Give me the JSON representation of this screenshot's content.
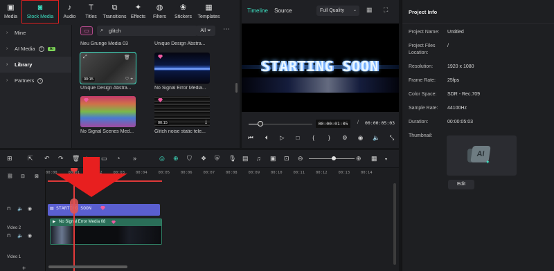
{
  "toolbar": {
    "items": [
      {
        "label": "Media",
        "icon": "media-icon",
        "glyph": "▣"
      },
      {
        "label": "Stock Media",
        "icon": "stock-media-icon",
        "glyph": "◙"
      },
      {
        "label": "Audio",
        "icon": "music-note-icon",
        "glyph": "♪"
      },
      {
        "label": "Titles",
        "icon": "text-icon",
        "glyph": "T"
      },
      {
        "label": "Transitions",
        "icon": "transitions-icon",
        "glyph": "⧉"
      },
      {
        "label": "Effects",
        "icon": "effects-icon",
        "glyph": "✦"
      },
      {
        "label": "Filters",
        "icon": "filters-icon",
        "glyph": "◍"
      },
      {
        "label": "Stickers",
        "icon": "stickers-icon",
        "glyph": "❀"
      },
      {
        "label": "Templates",
        "icon": "templates-icon",
        "glyph": "▦"
      }
    ],
    "active_index": 1
  },
  "sidebar": {
    "items": [
      {
        "label": "Mine"
      },
      {
        "label": "AI Media",
        "badge": "AI"
      },
      {
        "label": "Library"
      },
      {
        "label": "Partners"
      }
    ]
  },
  "search": {
    "value": "glitch",
    "filter_label": "All"
  },
  "media_grid": {
    "top_labels": [
      "Neu Grunge Media 03",
      "Unique Design Abstra..."
    ],
    "tiles": [
      {
        "label": "Unique Design Abstra...",
        "duration": "00:15"
      },
      {
        "label": "No Signal Error Media...",
        "duration": ""
      },
      {
        "label": "No Signal Scenes Med...",
        "duration": ""
      },
      {
        "label": "Glitch noise static tele...",
        "duration": "00:15"
      }
    ]
  },
  "player": {
    "tab_timeline": "Timeline",
    "tab_source": "Source",
    "quality": "Full Quality",
    "viewer_text": "STARTING SOON",
    "current_time": "00:00:01:05",
    "separator": "/",
    "total_time": "00:00:05:03",
    "progress": 0.18
  },
  "project_info": {
    "title": "Project Info",
    "rows": [
      {
        "label": "Project Name:",
        "value": "Untitled"
      },
      {
        "label": "Project Files",
        "label2": "Location:",
        "value": "/"
      },
      {
        "label": "Resolution:",
        "value": "1920 x 1080"
      },
      {
        "label": "Frame Rate:",
        "value": "25fps"
      },
      {
        "label": "Color Space:",
        "value": "SDR - Rec.709"
      },
      {
        "label": "Sample Rate:",
        "value": "44100Hz"
      },
      {
        "label": "Duration:",
        "value": "00:00:05:03"
      },
      {
        "label": "Thumbnail:",
        "value": ""
      }
    ],
    "thumb_text": "AI",
    "edit_label": "Edit"
  },
  "timeline": {
    "ruler": [
      "00:00",
      "00:01",
      "00:02",
      "00:03",
      "00:04",
      "00:05",
      "00:06",
      "00:07",
      "00:08",
      "00:09",
      "00:10",
      "00:11",
      "00:12",
      "00:13",
      "00:14"
    ],
    "tracks": [
      "Video 2",
      "Video 1"
    ],
    "title_clip": "STARTING SOON",
    "video_clip": "No Signal Error Media 08"
  },
  "colors": {
    "accent": "#3ee2c4",
    "highlight_red": "#e02020",
    "playhead": "#e53a3a"
  }
}
